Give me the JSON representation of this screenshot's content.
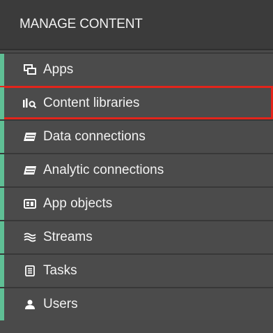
{
  "header": {
    "title": "MANAGE CONTENT"
  },
  "menu": {
    "items": [
      {
        "label": "Apps",
        "icon": "apps-icon"
      },
      {
        "label": "Content libraries",
        "icon": "content-libraries-icon"
      },
      {
        "label": "Data connections",
        "icon": "data-connections-icon"
      },
      {
        "label": "Analytic connections",
        "icon": "analytic-connections-icon"
      },
      {
        "label": "App objects",
        "icon": "app-objects-icon"
      },
      {
        "label": "Streams",
        "icon": "streams-icon"
      },
      {
        "label": "Tasks",
        "icon": "tasks-icon"
      },
      {
        "label": "Users",
        "icon": "users-icon"
      }
    ],
    "highlighted_item": "Content libraries"
  },
  "colors": {
    "panel_bg": "#4a4a4a",
    "header_bg": "#3b3b3b",
    "accent_stripe": "#5fbf95",
    "highlight_outline": "#e3241b",
    "text": "#f2f2f2"
  }
}
